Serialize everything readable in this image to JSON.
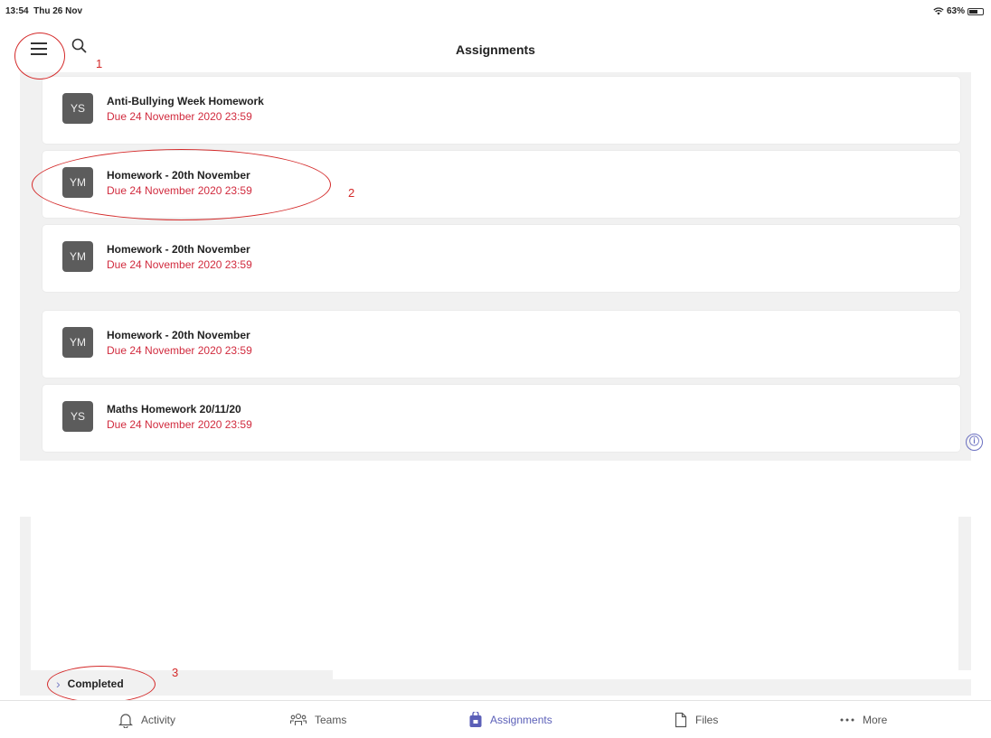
{
  "status": {
    "time": "13:54",
    "date": "Thu 26 Nov",
    "battery": "63%",
    "battery_level": 0.63
  },
  "header": {
    "title": "Assignments",
    "menu_icon": "hamburger-menu-icon",
    "search_icon": "search-icon"
  },
  "annotations": [
    "1",
    "2",
    "3"
  ],
  "assignments": [
    {
      "avatar": "YS",
      "title": "Anti-Bullying Week Homework",
      "due": "Due 24 November 2020 23:59"
    },
    {
      "avatar": "YM",
      "title": "Homework - 20th November",
      "due": "Due 24 November 2020 23:59"
    },
    {
      "avatar": "YM",
      "title": "Homework - 20th November",
      "due": "Due 24 November 2020 23:59"
    },
    {
      "avatar": "YM",
      "title": "Homework - 20th November",
      "due": "Due 24 November 2020 23:59"
    },
    {
      "avatar": "YS",
      "title": "Maths Homework 20/11/20",
      "due": "Due 24 November 2020 23:59"
    }
  ],
  "completed_label": "Completed",
  "info_icon": "ⓘ",
  "tabs": [
    {
      "label": "Activity",
      "icon": "bell-icon",
      "active": false
    },
    {
      "label": "Teams",
      "icon": "teams-icon",
      "active": false
    },
    {
      "label": "Assignments",
      "icon": "assignments-bag-icon",
      "active": true
    },
    {
      "label": "Files",
      "icon": "file-icon",
      "active": false
    },
    {
      "label": "More",
      "icon": "more-dots-icon",
      "active": false
    }
  ],
  "colors": {
    "accent": "#5b5fb8",
    "due_red": "#d12b3e",
    "annotation_red": "#d42a2a",
    "avatar_bg": "#5c5c5c"
  }
}
